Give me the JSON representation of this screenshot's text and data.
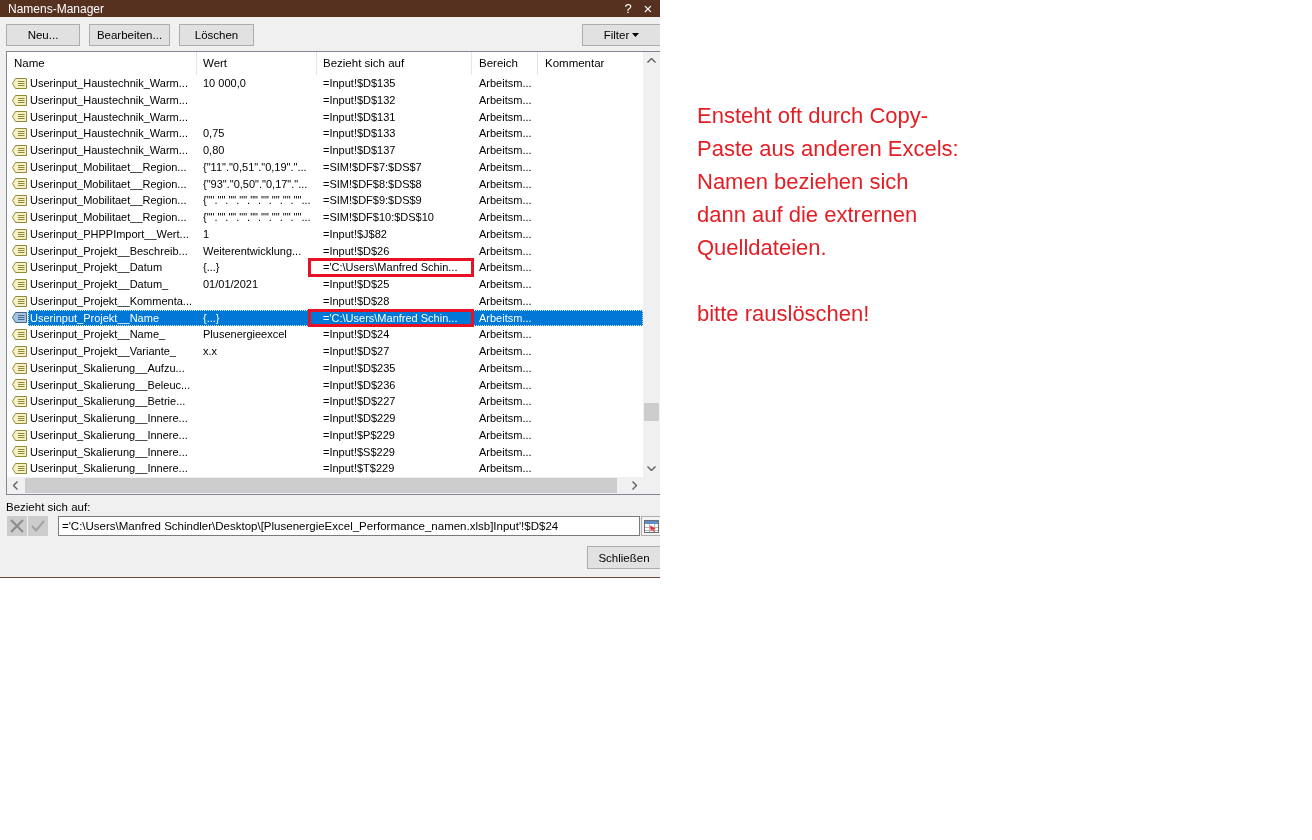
{
  "window": {
    "title": "Namens-Manager",
    "help": "?",
    "close": "×"
  },
  "toolbar": [
    {
      "kind": "new",
      "label": "Neu..."
    },
    {
      "kind": "edit",
      "label": "Bearbeiten..."
    },
    {
      "kind": "delete",
      "label": "Löschen"
    }
  ],
  "filter": {
    "label": "Filter"
  },
  "table": {
    "columns": [
      "Name",
      "Wert",
      "Bezieht sich auf",
      "Bereich",
      "Kommentar"
    ],
    "rows": [
      {
        "name": "Userinput_Haustechnik_Warm...",
        "value": "10 000,0",
        "refers_to": "=Input!$D$135",
        "scope": "Arbeitsm...",
        "selected": false,
        "annotated": false
      },
      {
        "name": "Userinput_Haustechnik_Warm...",
        "refers_to": "=Input!$D$132",
        "scope": "Arbeitsm...",
        "selected": false,
        "annotated": false
      },
      {
        "name": "Userinput_Haustechnik_Warm...",
        "refers_to": "=Input!$D$131",
        "scope": "Arbeitsm...",
        "selected": false,
        "annotated": false
      },
      {
        "name": "Userinput_Haustechnik_Warm...",
        "value": "0,75",
        "refers_to": "=Input!$D$133",
        "scope": "Arbeitsm...",
        "selected": false,
        "annotated": false
      },
      {
        "name": "Userinput_Haustechnik_Warm...",
        "value": "0,80",
        "refers_to": "=Input!$D$137",
        "scope": "Arbeitsm...",
        "selected": false,
        "annotated": false
      },
      {
        "name": "Userinput_Mobilitaet__Region...",
        "value": "{\"11\".\"0,51\".\"0,19\".\"...",
        "refers_to": "=SIM!$DF$7:$DS$7",
        "scope": "Arbeitsm...",
        "selected": false,
        "annotated": false
      },
      {
        "name": "Userinput_Mobilitaet__Region...",
        "value": "{\"93\".\"0,50\".\"0,17\".\"...",
        "refers_to": "=SIM!$DF$8:$DS$8",
        "scope": "Arbeitsm...",
        "selected": false,
        "annotated": false
      },
      {
        "name": "Userinput_Mobilitaet__Region...",
        "value": "{\"\".\"\".\"\".\"\".\"\".\"\".\"\".\"\".\"\"...",
        "refers_to": "=SIM!$DF$9:$DS$9",
        "scope": "Arbeitsm...",
        "selected": false,
        "annotated": false
      },
      {
        "name": "Userinput_Mobilitaet__Region...",
        "value": "{\"\".\"\".\"\".\"\".\"\".\"\".\"\".\"\".\"\"...",
        "refers_to": "=SIM!$DF$10:$DS$10",
        "scope": "Arbeitsm...",
        "selected": false,
        "annotated": false
      },
      {
        "name": "Userinput_PHPPImport__Wert...",
        "value": "1",
        "refers_to": "=Input!$J$82",
        "scope": "Arbeitsm...",
        "selected": false,
        "annotated": false
      },
      {
        "name": "Userinput_Projekt__Beschreib...",
        "value": "Weiterentwicklung...",
        "refers_to": "=Input!$D$26",
        "scope": "Arbeitsm...",
        "selected": false,
        "annotated": false
      },
      {
        "name": "Userinput_Projekt__Datum",
        "value": "{...}",
        "refers_to": "='C:\\Users\\Manfred Schin...",
        "scope": "Arbeitsm...",
        "selected": false,
        "annotated": true
      },
      {
        "name": "Userinput_Projekt__Datum_",
        "value": "01/01/2021",
        "refers_to": "=Input!$D$25",
        "scope": "Arbeitsm...",
        "selected": false,
        "annotated": false
      },
      {
        "name": "Userinput_Projekt__Kommenta...",
        "refers_to": "=Input!$D$28",
        "scope": "Arbeitsm...",
        "selected": false,
        "annotated": false
      },
      {
        "name": "Userinput_Projekt__Name",
        "value": "{...}",
        "refers_to": "='C:\\Users\\Manfred Schin...",
        "scope": "Arbeitsm...",
        "selected": true,
        "annotated": true
      },
      {
        "name": "Userinput_Projekt__Name_",
        "value": "Plusenergieexcel",
        "refers_to": "=Input!$D$24",
        "scope": "Arbeitsm...",
        "selected": false,
        "annotated": false
      },
      {
        "name": "Userinput_Projekt__Variante_",
        "value": "x.x",
        "refers_to": "=Input!$D$27",
        "scope": "Arbeitsm...",
        "selected": false,
        "annotated": false
      },
      {
        "name": "Userinput_Skalierung__Aufzu...",
        "refers_to": "=Input!$D$235",
        "scope": "Arbeitsm...",
        "selected": false,
        "annotated": false
      },
      {
        "name": "Userinput_Skalierung__Beleuc...",
        "refers_to": "=Input!$D$236",
        "scope": "Arbeitsm...",
        "selected": false,
        "annotated": false
      },
      {
        "name": "Userinput_Skalierung__Betrie...",
        "refers_to": "=Input!$D$227",
        "scope": "Arbeitsm...",
        "selected": false,
        "annotated": false
      },
      {
        "name": "Userinput_Skalierung__Innere...",
        "refers_to": "=Input!$D$229",
        "scope": "Arbeitsm...",
        "selected": false,
        "annotated": false
      },
      {
        "name": "Userinput_Skalierung__Innere...",
        "refers_to": "=Input!$P$229",
        "scope": "Arbeitsm...",
        "selected": false,
        "annotated": false
      },
      {
        "name": "Userinput_Skalierung__Innere...",
        "refers_to": "=Input!$S$229",
        "scope": "Arbeitsm...",
        "selected": false,
        "annotated": false
      },
      {
        "name": "Userinput_Skalierung__Innere...",
        "refers_to": "=Input!$T$229",
        "scope": "Arbeitsm...",
        "selected": false,
        "annotated": false
      }
    ]
  },
  "reference": {
    "label": "Bezieht sich auf:",
    "edit_buttons": [
      {
        "kind": "cancel",
        "disabled": true
      },
      {
        "kind": "confirm",
        "disabled": true
      }
    ],
    "value": "='C:\\Users\\Manfred Schindler\\Desktop\\[PlusenergieExcel_Performance_namen.xlsb]Input'!$D$24"
  },
  "close_button": {
    "label": "Schließen"
  },
  "note": {
    "paragraphs": [
      "Ensteht oft durch Copy-\nPaste aus anderen Excels:\nNamen beziehen sich\ndann auf die extrernen\nQuelldateien.",
      "bitte rauslöschen!"
    ]
  }
}
